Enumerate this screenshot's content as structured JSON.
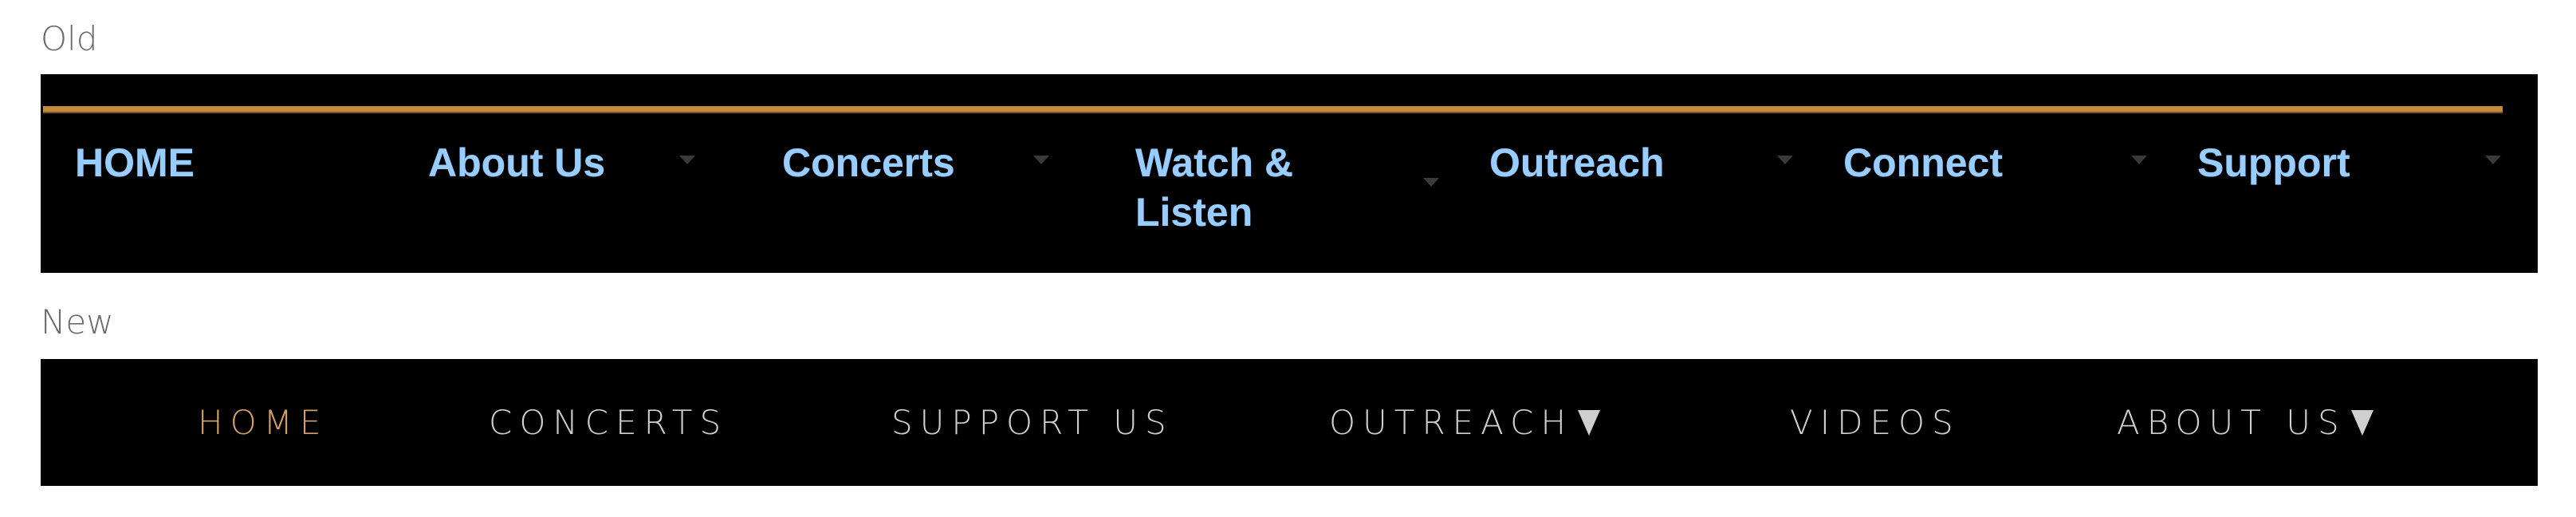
{
  "captions": {
    "old": "Old",
    "new": "New"
  },
  "colors": {
    "old_link": "#99ccff",
    "gold_rule": "#c48a3d",
    "new_link": "#cfcfcf",
    "new_active": "#d4a06a",
    "nav_background": "#000000"
  },
  "old_nav": {
    "items": [
      {
        "label": "HOME",
        "has_dropdown": false
      },
      {
        "label": "About Us",
        "has_dropdown": true
      },
      {
        "label": "Concerts",
        "has_dropdown": true
      },
      {
        "label": "Watch & Listen",
        "has_dropdown": true
      },
      {
        "label": "Outreach",
        "has_dropdown": true
      },
      {
        "label": "Connect",
        "has_dropdown": true
      },
      {
        "label": "Support",
        "has_dropdown": true
      }
    ]
  },
  "new_nav": {
    "items": [
      {
        "label": "HOME",
        "active": true,
        "has_dropdown": false
      },
      {
        "label": "CONCERTS",
        "active": false,
        "has_dropdown": false
      },
      {
        "label": "SUPPORT US",
        "active": false,
        "has_dropdown": false
      },
      {
        "label": "OUTREACH",
        "active": false,
        "has_dropdown": true
      },
      {
        "label": "VIDEOS",
        "active": false,
        "has_dropdown": false
      },
      {
        "label": "ABOUT US",
        "active": false,
        "has_dropdown": true
      }
    ]
  }
}
